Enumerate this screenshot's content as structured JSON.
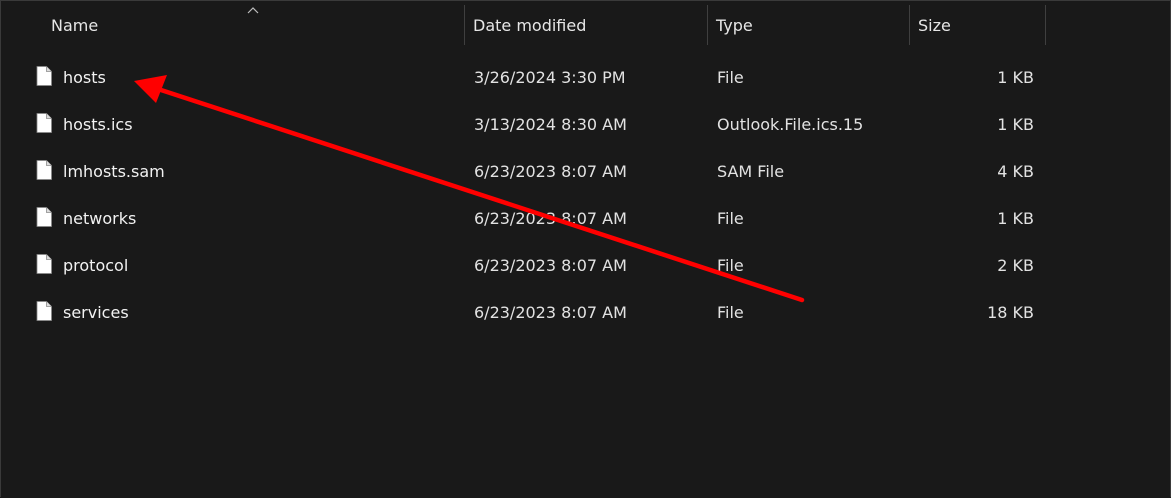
{
  "columns": {
    "name": "Name",
    "date_modified": "Date modified",
    "type": "Type",
    "size": "Size"
  },
  "sort": {
    "column": "name",
    "direction": "ascending",
    "icon": "chevron-up-icon"
  },
  "files": [
    {
      "name": "hosts",
      "date_modified": "3/26/2024 3:30 PM",
      "type": "File",
      "size": "1 KB",
      "icon": "file-icon"
    },
    {
      "name": "hosts.ics",
      "date_modified": "3/13/2024 8:30 AM",
      "type": "Outlook.File.ics.15",
      "size": "1 KB",
      "icon": "file-icon"
    },
    {
      "name": "lmhosts.sam",
      "date_modified": "6/23/2023 8:07 AM",
      "type": "SAM File",
      "size": "4 KB",
      "icon": "file-icon"
    },
    {
      "name": "networks",
      "date_modified": "6/23/2023 8:07 AM",
      "type": "File",
      "size": "1 KB",
      "icon": "file-icon"
    },
    {
      "name": "protocol",
      "date_modified": "6/23/2023 8:07 AM",
      "type": "File",
      "size": "2 KB",
      "icon": "file-icon"
    },
    {
      "name": "services",
      "date_modified": "6/23/2023 8:07 AM",
      "type": "File",
      "size": "18 KB",
      "icon": "file-icon"
    }
  ],
  "colors": {
    "background": "#191919",
    "text": "#f2f2f2",
    "annotation_arrow": "#ff0000"
  },
  "annotation": {
    "type": "arrow",
    "points_to": "hosts",
    "icon": "red-arrow-icon"
  }
}
